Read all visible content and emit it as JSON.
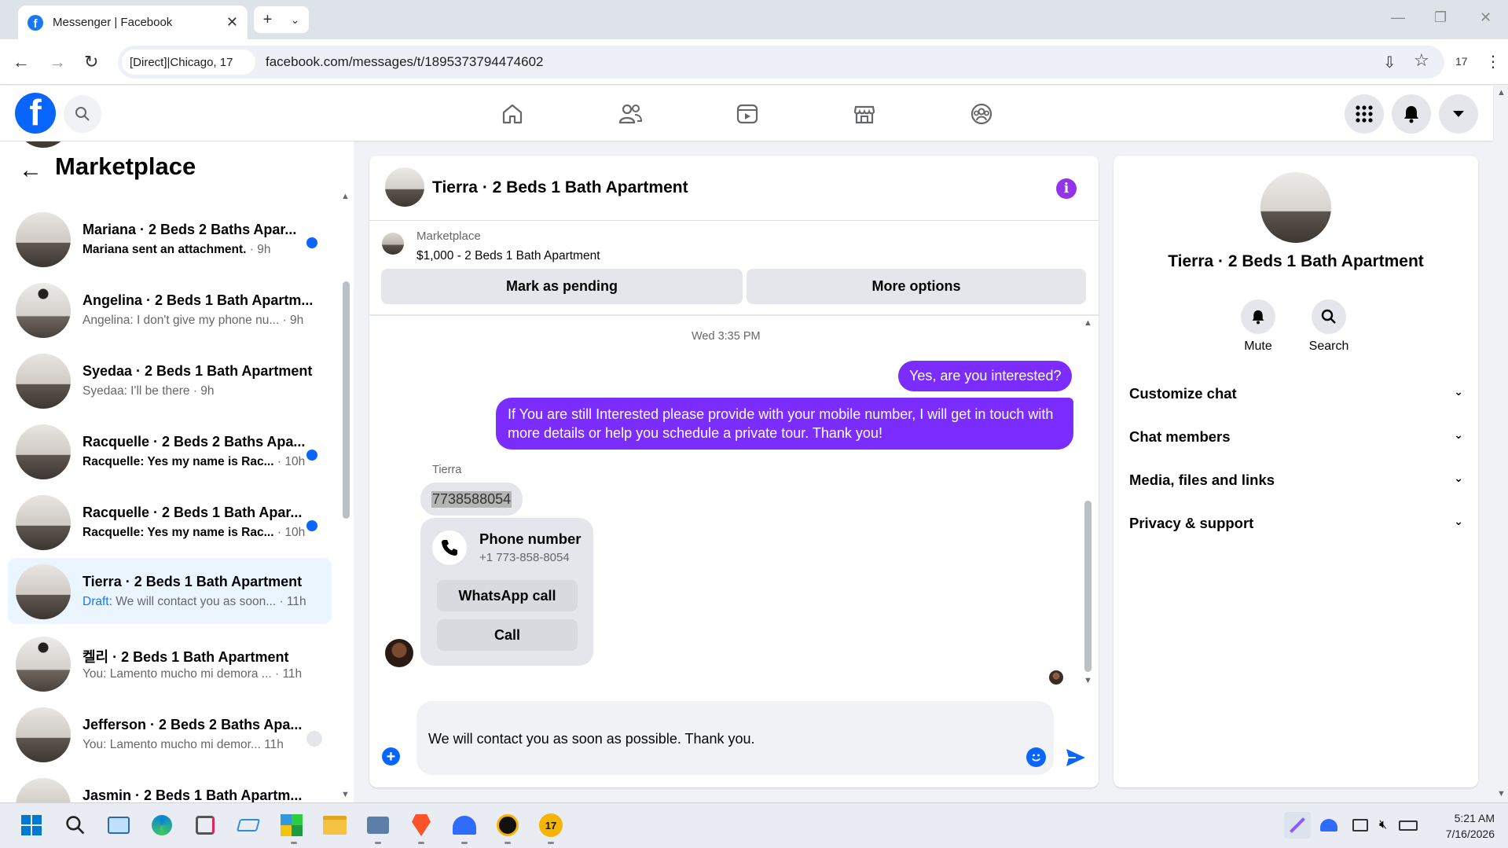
{
  "browser": {
    "tab_title": "Messenger | Facebook",
    "site_chip": "[Direct]|Chicago, 17",
    "url": "facebook.com/messages/t/1895373794474602",
    "ext_badge": "17"
  },
  "left": {
    "title": "Marketplace",
    "conversations": [
      {
        "name": "Mariana · 2 Beds 2 Baths Apar...",
        "preview": "Mariana sent an attachment.",
        "time": "· 9h",
        "unread": true
      },
      {
        "name": "Angelina · 2 Beds 1 Bath Apartm...",
        "preview": "Angelina: I don't give my phone nu...",
        "time": "· 9h",
        "unread": false
      },
      {
        "name": "Syedaa · 2 Beds 1 Bath Apartment",
        "preview": "Syedaa: I'll be there",
        "time": "· 9h",
        "unread": false
      },
      {
        "name": "Racquelle · 2 Beds 2 Baths Apa...",
        "preview": "Racquelle: Yes my name is Rac...",
        "time": "· 10h",
        "unread": true
      },
      {
        "name": "Racquelle · 2 Beds 1 Bath Apar...",
        "preview": "Racquelle: Yes my name is Rac...",
        "time": "· 10h",
        "unread": true
      },
      {
        "name": "Tierra · 2 Beds 1 Bath Apartment",
        "draft_label": "Draft:",
        "preview": "We will contact you as soon...",
        "time": "· 11h",
        "active": true
      },
      {
        "name": "켈리 · 2 Beds 1 Bath Apartment",
        "preview": "You: Lamento mucho mi demora ...",
        "time": "· 11h"
      },
      {
        "name": "Jefferson · 2 Beds 2 Baths Apa...",
        "preview": "You: Lamento mucho mi demor...",
        "time": "11h"
      },
      {
        "name": "Jasmin · 2 Beds 1 Bath Apartm...",
        "preview": "",
        "time": ""
      }
    ]
  },
  "chat": {
    "title": "Tierra · 2 Beds 1 Bath Apartment",
    "listing_label": "Marketplace",
    "listing_price": "$1,000 - 2 Beds 1 Bath Apartment",
    "mark_pending": "Mark as pending",
    "more_options": "More options",
    "timestamp": "Wed 3:35 PM",
    "msg_me_1": "Yes, are you interested?",
    "msg_me_2": "If You are still Interested please provide with your mobile number, I will get in touch with more details or help you schedule a private tour. Thank you!",
    "sender_name": "Tierra",
    "msg_them_1": "7738588054",
    "phone_card_title": "Phone number",
    "phone_card_number": "+1 773-858-8054",
    "whatsapp_call": "WhatsApp call",
    "call": "Call",
    "composer_text": "We will contact you as soon as possible. Thank you."
  },
  "right": {
    "name": "Tierra · 2 Beds 1 Bath Apartment",
    "mute": "Mute",
    "search": "Search",
    "sections": [
      "Customize chat",
      "Chat members",
      "Media, files and links",
      "Privacy & support"
    ]
  },
  "taskbar": {
    "time": "5:21 AM",
    "date": "7/16/2026",
    "badge": "17"
  },
  "colors": {
    "accent": "#0866ff",
    "my_bubble": "#7b2cff",
    "info": "#9333ea"
  }
}
